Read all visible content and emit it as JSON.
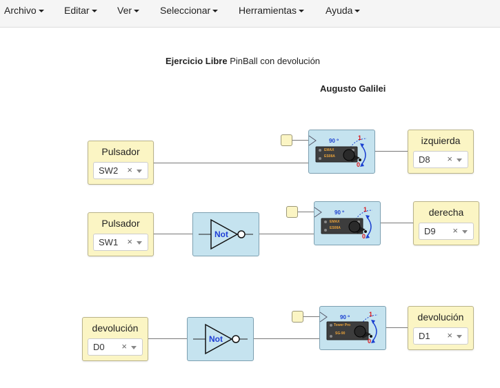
{
  "menu": [
    {
      "label": "Archivo"
    },
    {
      "label": "Editar"
    },
    {
      "label": "Ver"
    },
    {
      "label": "Seleccionar"
    },
    {
      "label": "Herramientas"
    },
    {
      "label": "Ayuda"
    }
  ],
  "header": {
    "exercise_prefix": "Ejercicio Libre",
    "exercise_name": "PinBall con devolución",
    "author": "Augusto Galilei"
  },
  "rows": [
    {
      "input": {
        "label": "Pulsador",
        "value": "SW2"
      },
      "servo": {
        "angle_max": "90 º",
        "mark_top": "1",
        "mark_bottom": "0",
        "brand": "EMAX",
        "model": "ES08A"
      },
      "output": {
        "label": "izquierda",
        "value": "D8"
      }
    },
    {
      "input": {
        "label": "Pulsador",
        "value": "SW1"
      },
      "gate": {
        "label": "Not"
      },
      "servo": {
        "angle_max": "90 º",
        "mark_top": "1",
        "mark_bottom": "0",
        "brand": "EMAX",
        "model": "ES08A"
      },
      "output": {
        "label": "derecha",
        "value": "D9"
      }
    },
    {
      "input": {
        "label": "devolución",
        "value": "D0"
      },
      "gate": {
        "label": "Not"
      },
      "servo": {
        "angle_max": "90 º",
        "mark_top": "1",
        "mark_bottom": "0",
        "brand": "Tower Pro",
        "model": "SG-90"
      },
      "output": {
        "label": "devolución",
        "value": "D1"
      }
    }
  ],
  "select_clear_symbol": "×",
  "colors": {
    "block_fill": "#fbf5c4",
    "gate_fill": "#c5e3ef",
    "gate_accent": "#1f3fd6",
    "servo_body": "#3d3d3d",
    "servo_text": "#e8a23a",
    "mark_one": "#d8141a",
    "mark_zero": "#d8141a",
    "angle_blue": "#1a3fd0"
  }
}
